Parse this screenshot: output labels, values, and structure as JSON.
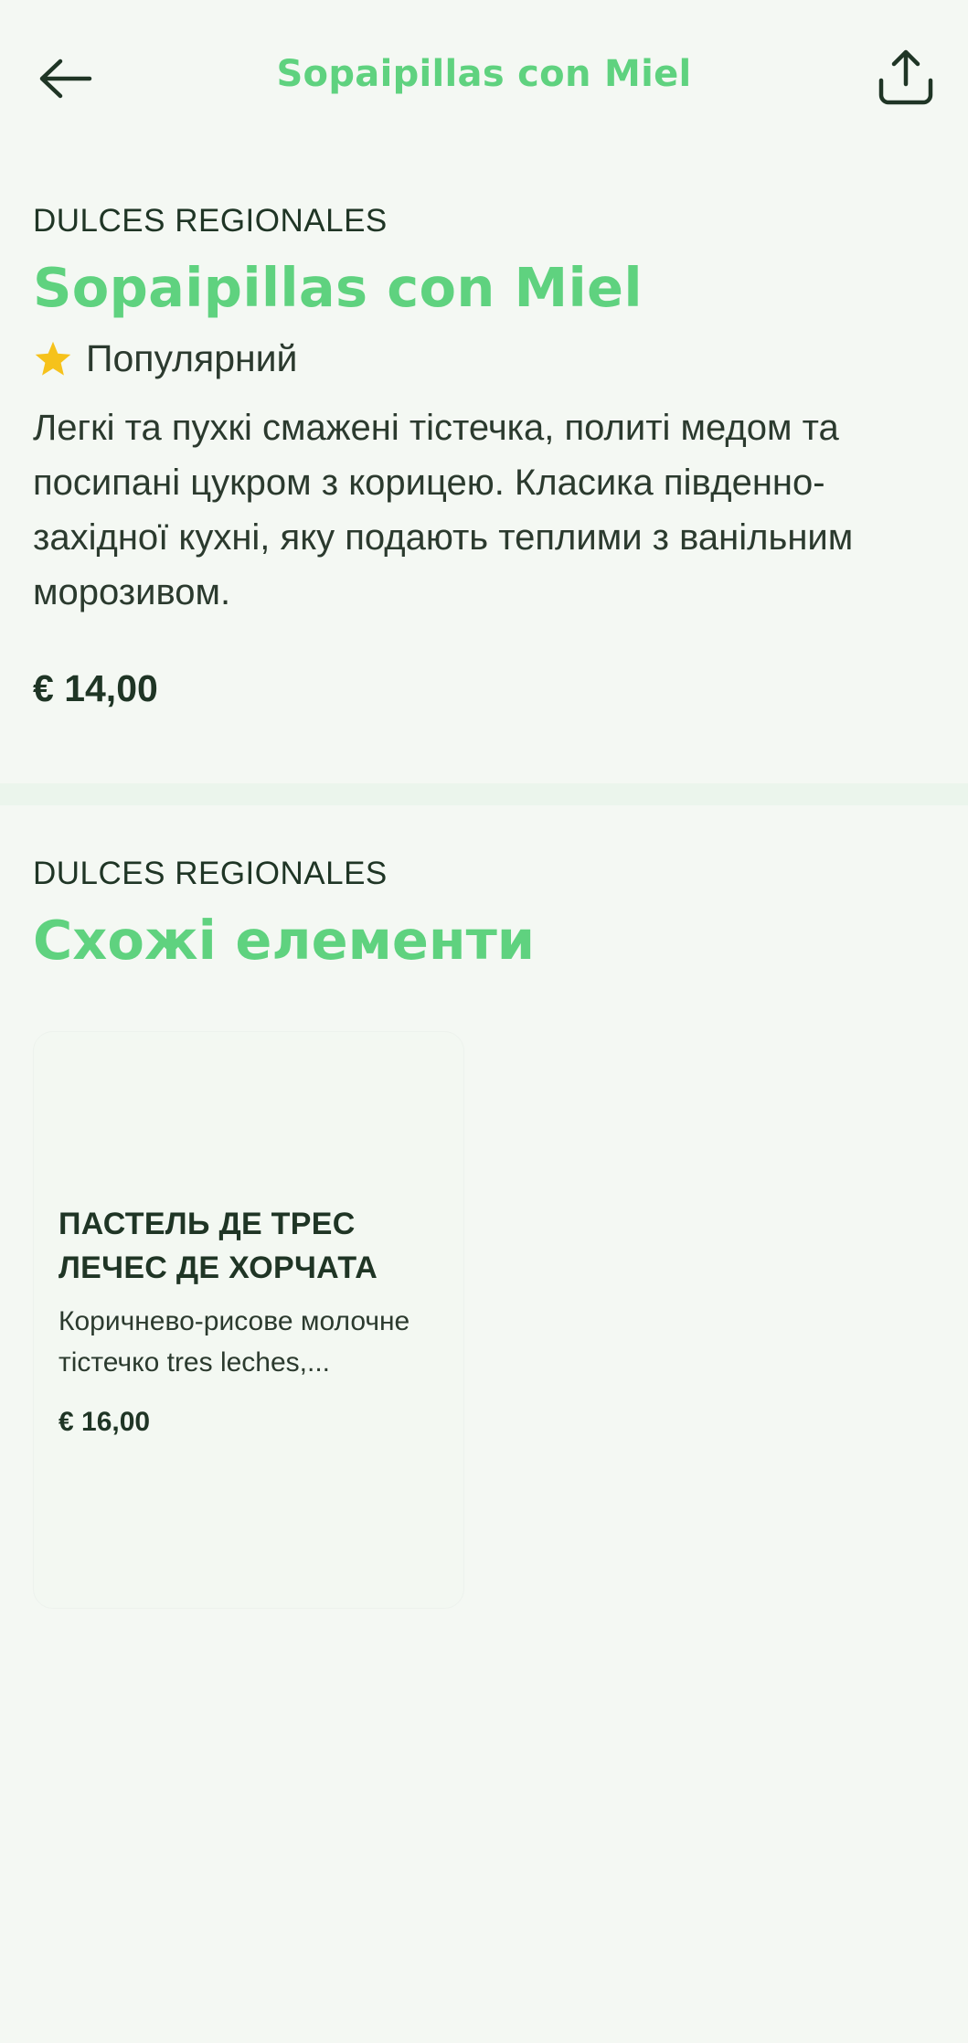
{
  "header": {
    "title": "Sopaipillas con Miel",
    "back_icon": "arrow-left-icon",
    "share_icon": "share-icon"
  },
  "item": {
    "category": "DULCES REGIONALES",
    "title": "Sopaipillas con Miel",
    "badge_icon": "star-icon",
    "badge_label": "Популярний",
    "description": "Легкі та пухкі смажені тістечка, политі медом та посипані цукром з корицею. Класика південно-західної кухні, яку подають теплими з ванільним морозивом.",
    "price": "€ 14,00"
  },
  "similar": {
    "category": "DULCES REGIONALES",
    "title": "Схожі елементи",
    "items": [
      {
        "title": "ПАСТЕЛЬ ДЕ ТРЕС ЛЕЧЕС ДЕ ХОРЧАТА",
        "description": "Коричнево-рисове молочне тістечко tres leches,...",
        "price": "€ 16,00"
      }
    ]
  },
  "colors": {
    "accent": "#5fd27f",
    "text": "#1f3525",
    "background": "#f4f8f3",
    "star": "#f6c21b"
  }
}
